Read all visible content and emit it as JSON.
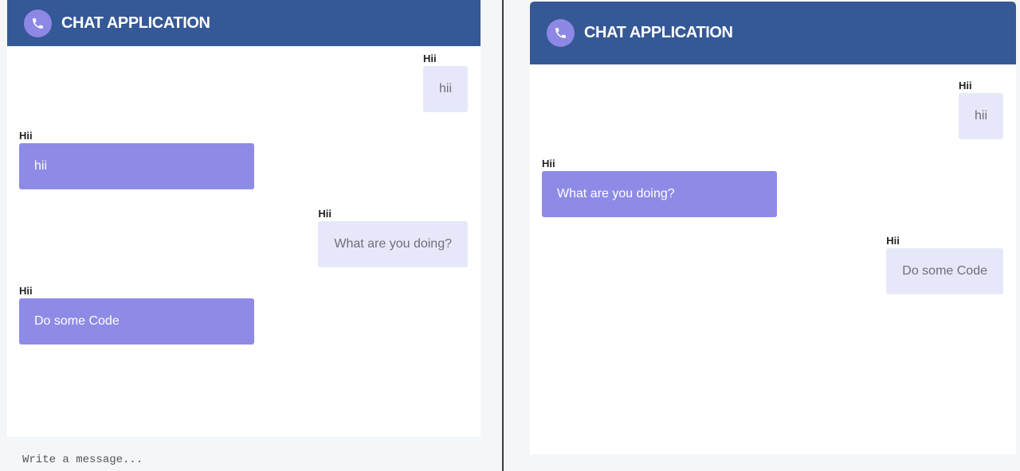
{
  "app": {
    "title": "CHAT APPLICATION",
    "icon": "phone-icon",
    "colors": {
      "header": "#355897",
      "accent": "#8d87e6",
      "received_bubble": "#8e8be6",
      "sent_bubble": "#e6e8fa"
    }
  },
  "left_window": {
    "messages": [
      {
        "sender": "Hii",
        "text": "hii",
        "direction": "sent"
      },
      {
        "sender": "Hii",
        "text": "hii",
        "direction": "received"
      },
      {
        "sender": "Hii",
        "text": "What are you doing?",
        "direction": "sent"
      },
      {
        "sender": "Hii",
        "text": "Do some Code",
        "direction": "received"
      }
    ],
    "composer": {
      "placeholder": "Write a message..."
    }
  },
  "right_window": {
    "messages": [
      {
        "sender": "Hii",
        "text": "hii",
        "direction": "sent"
      },
      {
        "sender": "Hii",
        "text": "What are you doing?",
        "direction": "received"
      },
      {
        "sender": "Hii",
        "text": "Do some Code",
        "direction": "sent"
      }
    ]
  }
}
